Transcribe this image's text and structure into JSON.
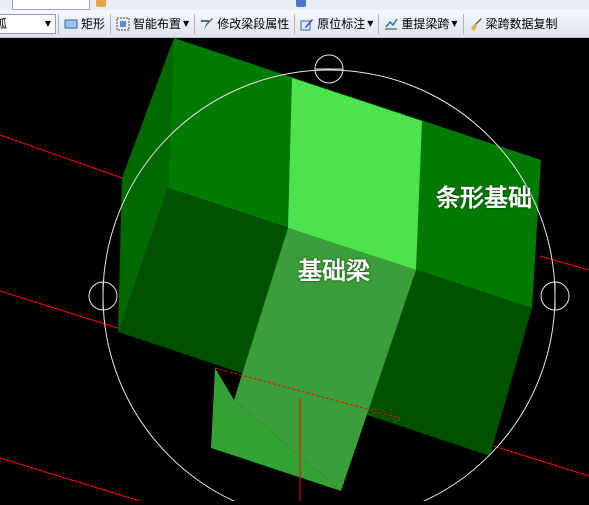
{
  "topbar": {
    "combo_value": "弧"
  },
  "toolbar": {
    "rect_label": "矩形",
    "smart_layout_label": "智能布置",
    "modify_props_label": "修改梁段属性",
    "orig_annotation_label": "原位标注",
    "relift_label": "重提梁跨",
    "copy_span_label": "梁跨数据复制"
  },
  "canvas": {
    "label_strip_footing": "条形基础",
    "label_foundation_beam": "基础梁",
    "colors": {
      "background": "#000000",
      "grid_line": "#ff0000",
      "footing_top": "#007a00",
      "footing_side": "#005200",
      "beam_top": "#4ee24e",
      "beam_side": "#3a9e3a"
    }
  }
}
